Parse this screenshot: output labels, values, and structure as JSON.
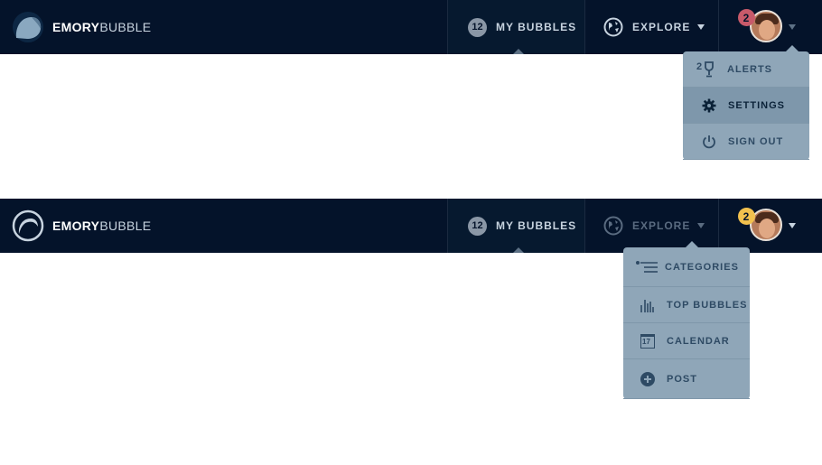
{
  "brand": {
    "bold": "EMORY",
    "thin": "BUBBLE"
  },
  "colors": {
    "navbar": "#04132a",
    "dropdown": "#8fa6b8",
    "alert_red": "#c85a6a",
    "alert_yellow": "#f2c14e"
  },
  "top": {
    "bubbles": {
      "count": "12",
      "label": "MY BUBBLES"
    },
    "explore": {
      "label": "EXPLORE"
    },
    "user": {
      "alerts_count": "2"
    },
    "user_menu": [
      {
        "icon": "trophy-icon",
        "badge": "2",
        "label": "ALERTS"
      },
      {
        "icon": "gear-icon",
        "label": "SETTINGS"
      },
      {
        "icon": "power-icon",
        "label": "SIGN OUT"
      }
    ]
  },
  "bottom": {
    "bubbles": {
      "count": "12",
      "label": "MY BUBBLES"
    },
    "explore": {
      "label": "EXPLORE"
    },
    "user": {
      "alerts_count": "2"
    },
    "explore_menu": [
      {
        "icon": "list-icon",
        "label": "CATEGORIES"
      },
      {
        "icon": "bar-chart-icon",
        "label": "TOP BUBBLES"
      },
      {
        "icon": "calendar-icon",
        "day": "17",
        "label": "CALENDAR"
      },
      {
        "icon": "plus-circle-icon",
        "label": "POST"
      }
    ]
  }
}
